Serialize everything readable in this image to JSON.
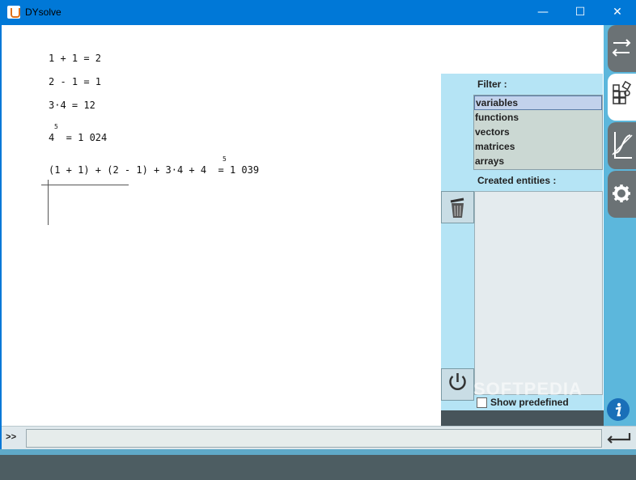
{
  "window": {
    "title": "DYsolve",
    "minimize": "—",
    "maximize": "☐",
    "close": "✕"
  },
  "math": {
    "lines": [
      "1 + 1 = 2",
      "2 - 1 = 1",
      "3·4 = 12",
      "4  = 1 024",
      "(1 + 1) + (2 - 1) + 3·4 + 4  = 1 039"
    ],
    "exponents": [
      "5",
      "5"
    ]
  },
  "panel": {
    "filter_label": "Filter :",
    "filter_items": [
      "variables",
      "functions",
      "vectors",
      "matrices",
      "arrays"
    ],
    "filter_selected": "variables",
    "entities_label": "Created entities :",
    "show_predefined_label": "Show predefined",
    "show_predefined_checked": false
  },
  "tabs": [
    "arrows-tab",
    "entities-tab",
    "graph-tab",
    "settings-tab",
    "info-tab"
  ],
  "command": {
    "prompt": ">>",
    "value": ""
  },
  "watermark": "SOFTPEDIA",
  "colors": {
    "titlebar": "#0078d7",
    "panel": "#b5e4f5",
    "rail": "#5cb7dc",
    "tab": "#6b7275"
  }
}
